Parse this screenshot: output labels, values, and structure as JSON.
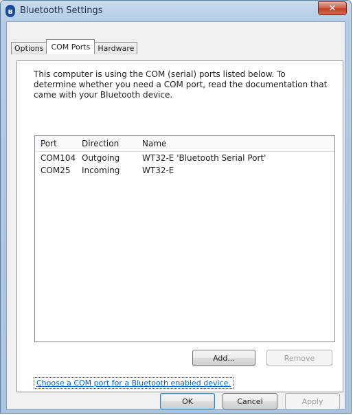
{
  "window": {
    "title": "Bluetooth Settings",
    "close_glyph": "✕",
    "icon": "bluetooth-icon"
  },
  "tabs": [
    {
      "label": "Options",
      "active": false
    },
    {
      "label": "COM Ports",
      "active": true
    },
    {
      "label": "Hardware",
      "active": false
    }
  ],
  "panel": {
    "intro_text": "This computer is using the COM (serial) ports listed below. To determine whether you need a COM port, read the documentation that came with your Bluetooth device.",
    "columns": {
      "port": "Port",
      "direction": "Direction",
      "name": "Name"
    },
    "rows": [
      {
        "port": "COM104",
        "direction": "Outgoing",
        "name": "WT32-E 'Bluetooth Serial Port'"
      },
      {
        "port": "COM25",
        "direction": "Incoming",
        "name": "WT32-E"
      }
    ],
    "add_label": "Add...",
    "remove_label": "Remove",
    "link_text": "Choose a COM port for a Bluetooth enabled device."
  },
  "footer": {
    "ok_label": "OK",
    "cancel_label": "Cancel",
    "apply_label": "Apply"
  },
  "colors": {
    "link": "#0066cc",
    "close_button": "#c23d26",
    "title_bar": "#b9cfe6"
  }
}
